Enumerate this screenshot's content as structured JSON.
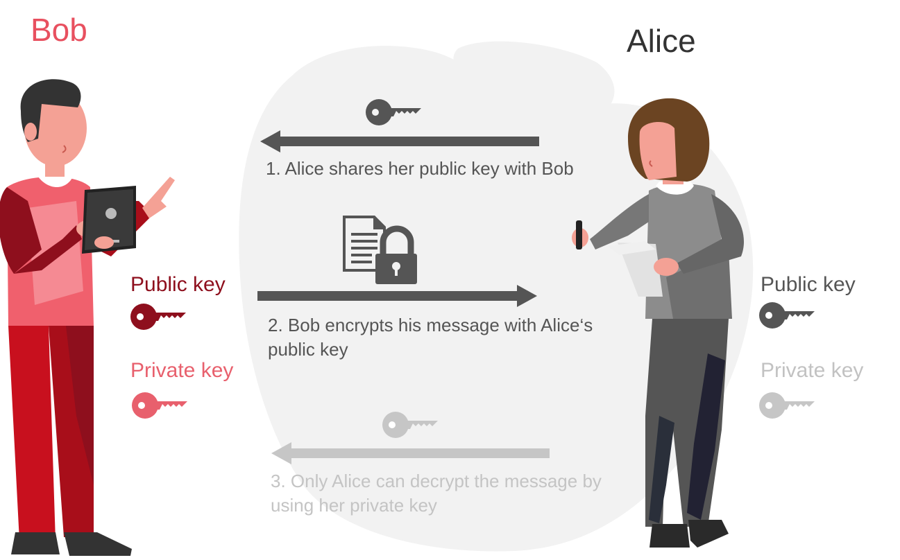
{
  "people": {
    "bob": {
      "name": "Bob"
    },
    "alice": {
      "name": "Alice"
    }
  },
  "steps": [
    {
      "text": "1. Alice shares her public key with Bob"
    },
    {
      "line1": "2. Bob encrypts his message with Alice‘s",
      "line2": "public key"
    },
    {
      "line1": "3. Only Alice can decrypt the message by",
      "line2": "using her private key"
    }
  ],
  "keys": {
    "bob_public": "Public key",
    "bob_private": "Private key",
    "alice_public": "Public key",
    "alice_private": "Private key"
  },
  "colors": {
    "bob_accent": "#e8505f",
    "bob_dark": "#8e0f1d",
    "bob_light": "#e8606d",
    "alice_dark": "#555555",
    "alice_light": "#c4c4c4",
    "blob": "#f2f2f2"
  },
  "icons": [
    "key-icon",
    "document-icon",
    "padlock-icon",
    "arrow-left",
    "arrow-right"
  ]
}
